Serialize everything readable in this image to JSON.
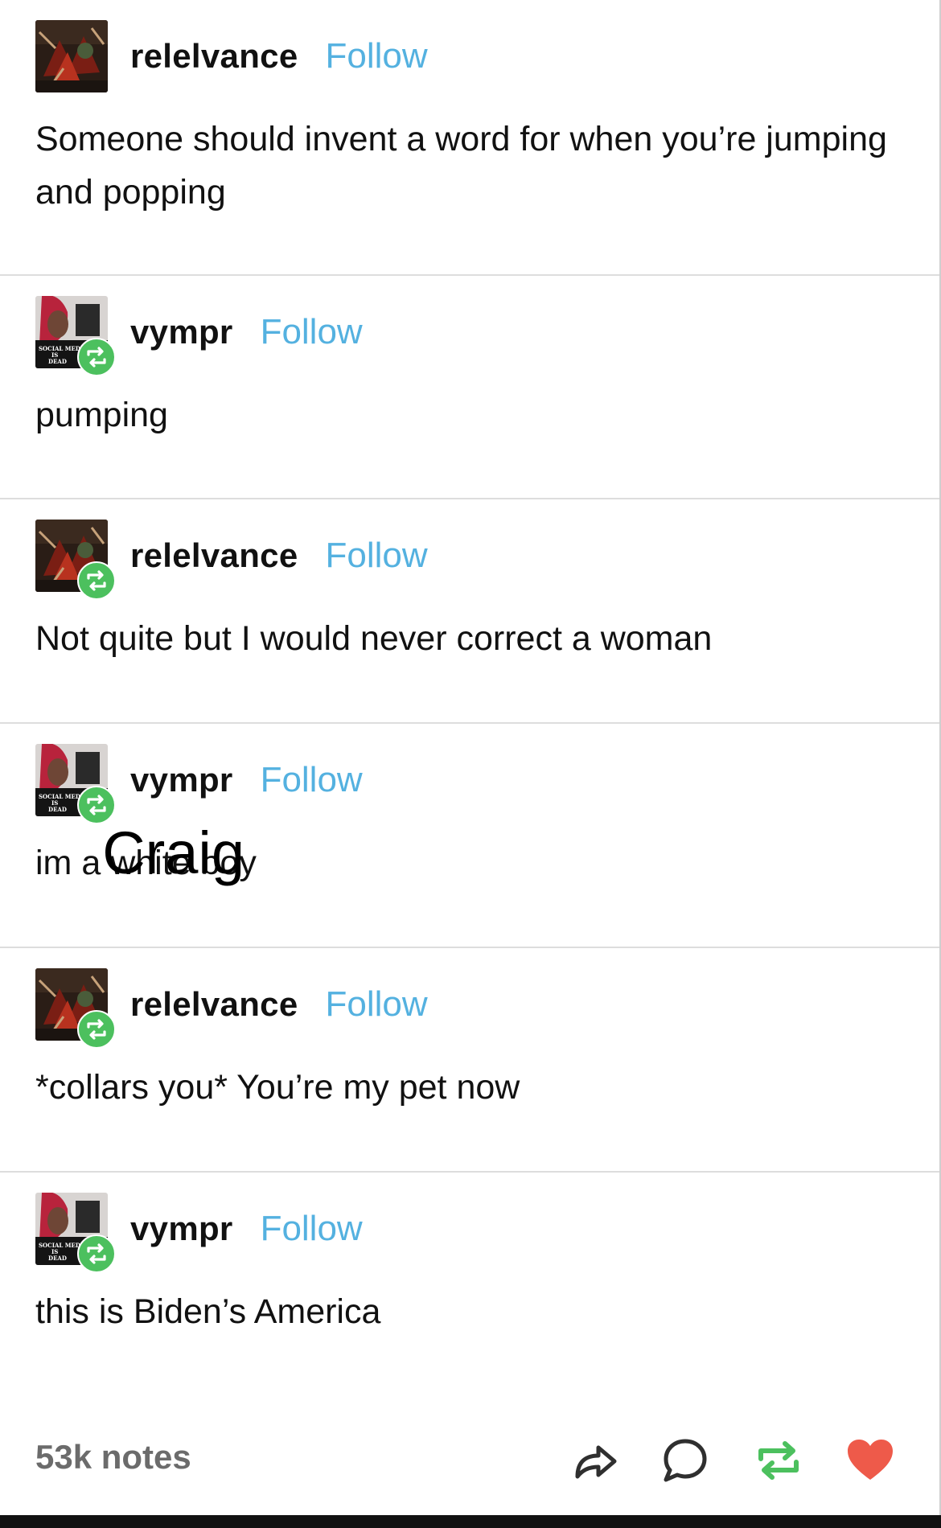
{
  "posts": [
    {
      "username": "relelvance",
      "follow_label": "Follow",
      "avatar": "avatar-relelvance",
      "is_reblog": false,
      "text": "Someone should invent a word for when you’re jumping and popping"
    },
    {
      "username": "vympr",
      "follow_label": "Follow",
      "avatar": "avatar-vympr",
      "is_reblog": true,
      "text": "pumping"
    },
    {
      "username": "relelvance",
      "follow_label": "Follow",
      "avatar": "avatar-relelvance",
      "is_reblog": true,
      "text": "Not quite but I would never correct a woman"
    },
    {
      "username": "vympr",
      "follow_label": "Follow",
      "avatar": "avatar-vympr",
      "is_reblog": true,
      "text_prefix": "im a ",
      "text_obscured": "white boy",
      "overlay_text": "Craig"
    },
    {
      "username": "relelvance",
      "follow_label": "Follow",
      "avatar": "avatar-relelvance",
      "is_reblog": true,
      "text": "*collars you* You’re my pet now"
    },
    {
      "username": "vympr",
      "follow_label": "Follow",
      "avatar": "avatar-vympr",
      "is_reblog": true,
      "text": "this is Biden’s America"
    }
  ],
  "footer": {
    "notes": "53k notes",
    "actions": [
      "share-icon",
      "reply-icon",
      "reblog-icon",
      "like-icon"
    ]
  },
  "avatar_text": {
    "vympr": [
      "SOCIAL MEDIA",
      "IS",
      "DEAD"
    ]
  },
  "colors": {
    "follow": "#54b1e0",
    "reblog_badge": "#4cc05e",
    "like": "#ee5a4a",
    "divider": "#dddddd",
    "notes": "#6b6b6b"
  }
}
